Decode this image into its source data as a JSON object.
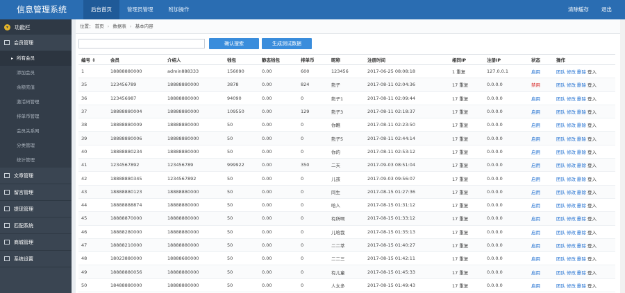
{
  "header": {
    "brand": "信息管理系统",
    "nav": [
      "后台首页",
      "管理员管理",
      "附加操作"
    ],
    "right": [
      "清除缓存",
      "退出"
    ]
  },
  "sidebar": {
    "title": "功能栏",
    "groups": [
      {
        "label": "会员管理",
        "open": true,
        "items": [
          "所有会员",
          "添加会员",
          "余额充值",
          "激活码管理",
          "排单币管理",
          "会员关系网",
          "分类管理",
          "统计管理"
        ]
      },
      {
        "label": "文章管理"
      },
      {
        "label": "留言管理"
      },
      {
        "label": "提现管理"
      },
      {
        "label": "匹配系统"
      },
      {
        "label": "商城管理"
      },
      {
        "label": "系统设置"
      }
    ],
    "active_item": "所有会员"
  },
  "breadcrumb": {
    "label": "位置：",
    "items": [
      "首页",
      "数据表",
      "基本内容"
    ]
  },
  "toolbar": {
    "search_value": "",
    "search_placeholder": "",
    "btn_search": "确认搜索",
    "btn_generate": "生成测试数据"
  },
  "table": {
    "headers": [
      "编号 ⇕",
      "会员",
      "介绍人",
      "钱包",
      "静态钱包",
      "排单币",
      "昵称",
      "注册时间",
      "相同IP",
      "注册IP",
      "状态",
      "操作"
    ],
    "ops": [
      "团队",
      "修改",
      "删除",
      "登入"
    ],
    "rows": [
      [
        "1",
        "18888880000",
        "admin888333",
        "156090",
        "0.00",
        "600",
        "123456",
        "2017-06-25 08:08:18",
        "1 重复",
        "127.0.0.1",
        "启用"
      ],
      [
        "35",
        "123456789",
        "18888880000",
        "3878",
        "0.00",
        "824",
        "熊子",
        "2017-08-11 02:04:36",
        "17 重复",
        "0.0.0.0",
        "禁用"
      ],
      [
        "36",
        "123456987",
        "18888880000",
        "94090",
        "0.00",
        "0",
        "熊子1",
        "2017-08-11 02:09:44",
        "17 重复",
        "0.0.0.0",
        "启用"
      ],
      [
        "37",
        "18888880004",
        "18888880000",
        "109550",
        "0.00",
        "129",
        "熊子3",
        "2017-08-11 02:18:37",
        "17 重复",
        "0.0.0.0",
        "启用"
      ],
      [
        "38",
        "18888880009",
        "18888880000",
        "50",
        "0.00",
        "0",
        "你瞧",
        "2017-08-11 02:23:50",
        "17 重复",
        "0.0.0.0",
        "启用"
      ],
      [
        "39",
        "18888880006",
        "18888880000",
        "50",
        "0.00",
        "0",
        "熊子5",
        "2017-08-11 02:44:14",
        "17 重复",
        "0.0.0.0",
        "启用"
      ],
      [
        "40",
        "18888880234",
        "18888880000",
        "50",
        "0.00",
        "0",
        "你的",
        "2017-08-11 02:53:12",
        "17 重复",
        "0.0.0.0",
        "启用"
      ],
      [
        "41",
        "1234567892",
        "123456789",
        "999922",
        "0.00",
        "350",
        "二天",
        "2017-09-03 08:51:04",
        "17 重复",
        "0.0.0.0",
        "启用"
      ],
      [
        "42",
        "18888880345",
        "1234567892",
        "50",
        "0.00",
        "0",
        "儿孩",
        "2017-09-03 09:56:07",
        "17 重复",
        "0.0.0.0",
        "启用"
      ],
      [
        "43",
        "18888880123",
        "18888880000",
        "50",
        "0.00",
        "0",
        "同生",
        "2017-08-15 01:27:36",
        "17 重复",
        "0.0.0.0",
        "启用"
      ],
      [
        "44",
        "18888888874",
        "18888880000",
        "50",
        "0.00",
        "0",
        "哈人",
        "2017-08-15 01:31:12",
        "17 重复",
        "0.0.0.0",
        "启用"
      ],
      [
        "45",
        "18888870000",
        "18888880000",
        "50",
        "0.00",
        "0",
        "有所啊",
        "2017-08-15 01:33:12",
        "17 重复",
        "0.0.0.0",
        "启用"
      ],
      [
        "46",
        "18888280000",
        "18888880000",
        "50",
        "0.00",
        "0",
        "儿哈我",
        "2017-08-15 01:35:13",
        "17 重复",
        "0.0.0.0",
        "启用"
      ],
      [
        "47",
        "18888210000",
        "18888880000",
        "50",
        "0.00",
        "0",
        "二二萃",
        "2017-08-15 01:40:27",
        "17 重复",
        "0.0.0.0",
        "启用"
      ],
      [
        "48",
        "18023880000",
        "18888680000",
        "50",
        "0.00",
        "0",
        "二二三",
        "2017-08-15 01:42:11",
        "17 重复",
        "0.0.0.0",
        "启用"
      ],
      [
        "49",
        "18888880056",
        "18888880000",
        "50",
        "0.00",
        "0",
        "有儿童",
        "2017-08-15 01:45:33",
        "17 重复",
        "0.0.0.0",
        "启用"
      ],
      [
        "50",
        "18488880000",
        "18888880000",
        "50",
        "0.00",
        "0",
        "人太多",
        "2017-08-15 01:49:43",
        "17 重复",
        "0.0.0.0",
        "启用"
      ]
    ]
  },
  "colors": {
    "topbar": "#2a6db2",
    "sidebar": "#3a4552",
    "button": "#3a8ddc",
    "link": "#1f6fd1",
    "disabled": "#d9302f"
  }
}
